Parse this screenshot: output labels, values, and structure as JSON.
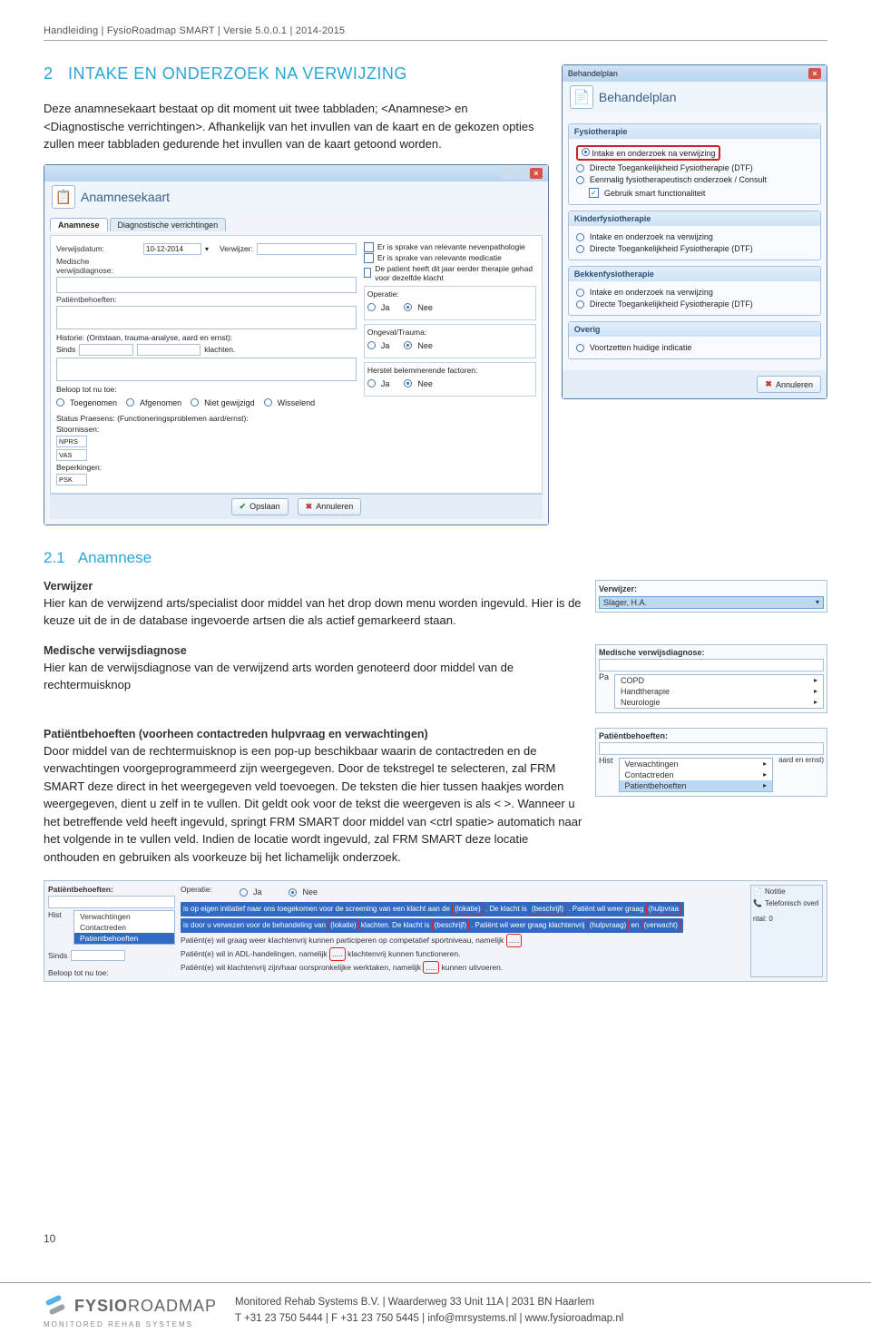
{
  "header": {
    "line": "Handleiding  |  FysioRoadmap SMART  |  Versie 5.0.0.1  |  2014-2015"
  },
  "section": {
    "num": "2",
    "title": "INTAKE EN ONDERZOEK NA VERWIJZING",
    "intro": "Deze anamnesekaart bestaat op dit moment uit twee tabbladen; <Anamnese> en <Diagnostische verrichtingen>. Afhankelijk van het invullen van de kaart en de gekozen opties zullen meer tabbladen gedurende het invullen van de kaart getoond worden."
  },
  "behandelplan": {
    "title": "Behandelplan",
    "ribbon": "Behandelplan",
    "groups": [
      {
        "name": "Fysiotherapie",
        "items": [
          {
            "label": "Intake en onderzoek na verwijzing",
            "sel": true,
            "frame": true
          },
          {
            "label": "Directe Toegankelijkheid Fysiotherapie (DTF)",
            "sel": false
          },
          {
            "label": "Eenmalig fysiotherapeutisch onderzoek / Consult",
            "sel": false
          }
        ],
        "check": {
          "label": "Gebruik smart functionaliteit",
          "on": true
        }
      },
      {
        "name": "Kinderfysiotherapie",
        "items": [
          {
            "label": "Intake en onderzoek na verwijzing",
            "sel": false
          },
          {
            "label": "Directe Toegankelijkheid Fysiotherapie (DTF)",
            "sel": false
          }
        ]
      },
      {
        "name": "Bekkenfysiotherapie",
        "items": [
          {
            "label": "Intake en onderzoek na verwijzing",
            "sel": false
          },
          {
            "label": "Directe Toegankelijkheid Fysiotherapie (DTF)",
            "sel": false
          }
        ]
      },
      {
        "name": "Overig",
        "items": [
          {
            "label": "Voortzetten huidige indicatie",
            "sel": false
          }
        ]
      }
    ],
    "cancel": "Annuleren"
  },
  "anamShot": {
    "title": "Anamnesekaart",
    "tabs": [
      "Anamnese",
      "Diagnostische verrichtingen"
    ],
    "labels": {
      "verwijsdatum": "Verwijsdatum:",
      "date": "10-12-2014",
      "verwijzer": "Verwijzer:",
      "meddiag": "Medische verwijsdiagnose:",
      "patbeh": "Patiëntbehoeften:",
      "historie": "Historie: (Ontstaan, trauma-analyse, aard en ernst):",
      "sinds": "Sinds",
      "klachten": "klachten.",
      "beloop": "Beloop tot nu toe:",
      "beloopOpts": [
        "Toegenomen",
        "Afgenomen",
        "Niet gewijzigd",
        "Wisselend"
      ],
      "status": "Status Praesens: (Functioneringsproblemen aard/ernst):",
      "stoorn": "Stoornissen:",
      "stoornOpts": [
        "NPRS",
        "VAS"
      ],
      "beperk": "Beperkingen:",
      "beperkOpt": "PSK",
      "checks": [
        "Er is sprake van relevante nevenpathologie",
        "Er is sprake van relevante medicatie",
        "De patient heeft dit jaar eerder therapie gehad voor dezelfde klacht"
      ],
      "operatie": "Operatie:",
      "ongeval": "Ongeval/Trauma:",
      "herstel": "Herstel belemmerende factoren:",
      "ja": "Ja",
      "nee": "Nee",
      "opslaan": "Opslaan",
      "annuleren": "Annuleren"
    }
  },
  "sub": {
    "num": "2.1",
    "title": "Anamnese",
    "verwijzer": {
      "h": "Verwijzer",
      "t": "Hier kan de verwijzend arts/specialist door middel van het drop down menu worden ingevuld. Hier is de keuze uit de in de database ingevoerde artsen die als actief gemarkeerd staan."
    },
    "meddiag": {
      "h": "Medische verwijsdiagnose",
      "t": "Hier kan de verwijsdiagnose van de verwijzend arts worden genoteerd door middel van de rechtermuisknop"
    },
    "patbeh": {
      "h": "Patiëntbehoeften (voorheen contactreden hulpvraag en verwachtingen)",
      "t": "Door middel van de rechtermuisknop is een pop-up beschikbaar waarin de contactreden en de verwachtingen voorgeprogrammeerd zijn weergegeven. Door de tekstregel te selecteren, zal FRM SMART deze direct in het weergegeven veld toevoegen. De teksten die hier tussen haakjes worden weergegeven, dient u zelf in te vullen. Dit geldt ook voor de tekst die weergeven is als < >. Wanneer u het betreffende veld heeft ingevuld, springt FRM SMART door middel van <ctrl spatie> automatich naar het volgende in te vullen veld.  Indien de locatie wordt ingevuld, zal FRM SMART deze locatie onthouden en gebruiken als voorkeuze bij het lichamelijk onderzoek."
    }
  },
  "miniVerwijzer": {
    "label": "Verwijzer:",
    "value": "Slager, H.A."
  },
  "miniDiag": {
    "label": "Medische verwijsdiagnose:",
    "pa": "Pa",
    "items": [
      "COPD",
      "Handtherapie",
      "Neurologie"
    ]
  },
  "miniPatbeh": {
    "label": "Patiëntbehoeften:",
    "hist": "Hist",
    "aard": "aard en ernst)",
    "items": [
      "Verwachtingen",
      "Contactreden",
      "Patientbehoeften"
    ]
  },
  "wideShot": {
    "label": "Patiëntbehoeften:",
    "hist": "Hist",
    "sinds": "Sinds",
    "beloop": "Beloop tot nu toe:",
    "operatie": "Operatie:",
    "ja": "Ja",
    "nee": "Nee",
    "menu": [
      "Verwachtingen",
      "Contactreden",
      "Patientbehoeften"
    ],
    "line1a": "is op eigen initiatief naar ons toegekomen voor de screening van een klacht aan de",
    "line1_lokatie": "(lokatie)",
    "line1b": ". De klacht is",
    "line1_beschrijf": "(beschrijf)",
    "line1c": ". Patiënt wil weer graag",
    "line1_hulpvraag": "(hulpvraa",
    "line2a": "is door u verwezen voor de behandeling van",
    "line2_lokatie": "(lokatie)",
    "line2b": "klachten. De klacht is",
    "line2_beschrijf": "(beschrijf)",
    "line2c": ". Patiënt wil weer graag klachtenvrij",
    "line2_hulpvraag": "(hulpvraag)",
    "line2d": "en",
    "line2_verwacht": "(verwacht)",
    "l3": "Patiënt(e) wil graag weer klachtenvrij kunnen participeren op competatief sportniveau, namelijk",
    "l4a": "Patiënt(e) wil in ADL-handelingen, namelijk",
    "l4b": "klachtenvrij kunnen functioneren.",
    "l5a": "Patiënt(e) wil klachtenvrij zijn/haar oorspronkelijke werktaken, namelijk",
    "l5b": "kunnen uitvoeren.",
    "dots": ".....",
    "side": {
      "notitie": "Notitie",
      "tel": "Telefonisch overl",
      "ntal": "ntal:   0"
    }
  },
  "pageNum": "10",
  "footer": {
    "brand1": "FYSIO",
    "brand2": "ROADMAP",
    "sub": "MONITORED REHAB SYSTEMS",
    "line1": "Monitored Rehab Systems B.V.  |  Waarderweg 33 Unit 11A  |  2031 BN Haarlem",
    "line2": "T  +31 23 750 5444  |  F  +31 23 750 5445  |  info@mrsystems.nl  |  www.fysioroadmap.nl"
  }
}
